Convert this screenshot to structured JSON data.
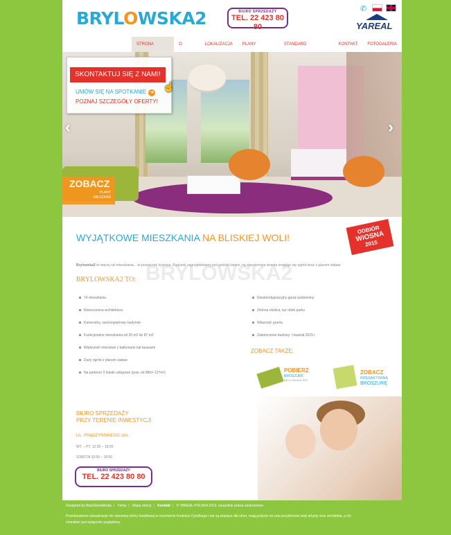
{
  "header": {
    "logo_main": "BRYL",
    "logo_o": "O",
    "logo_rest": "WSKA",
    "logo_num": "2",
    "phone_caption": "BIURO SPRZEDAŻY",
    "phone_number": "TEL. 22 423 80 80",
    "developer": "YAREAL",
    "icons": [
      "phone-icon",
      "flag-pl-icon",
      "flag-en-icon"
    ]
  },
  "nav": {
    "items": [
      {
        "label": "STRONA GŁÓWNA",
        "active": true
      },
      {
        "label": "O FIRMIE"
      },
      {
        "label": "LOKALIZACJA"
      },
      {
        "label": "PLANY MIESZKAŃ"
      },
      {
        "label": "STANDARD TECHNICZNY"
      },
      {
        "label": "KONTAKT"
      },
      {
        "label": "FOTOGALERIA"
      }
    ]
  },
  "hero": {
    "contact_button": "SKONTAKTUJ SIĘ Z NAMI!",
    "meeting_link": "UMÓW SIĘ NA SPOTKANIE",
    "details_link": "POZNAJ SZCZEGÓŁY OFERTY!",
    "see_title": "ZOBACZ",
    "see_sub1": "PLANY",
    "see_sub2": "MIESZKAŃ",
    "prev_symbol": "‹",
    "next_symbol": "›"
  },
  "main": {
    "tagline_part1": "WYJĄTKOWE MIESZKANIA",
    "tagline_part2": "NA BLISKIEJ WOLI!",
    "promo_line1": "ODBIÓR",
    "promo_line2": "WIOSNA",
    "promo_line3": "2015",
    "watermark": "BRYLOWSKA2",
    "intro_brand": "Brylowska2",
    "intro_rest": "to więcej niż mieszkania... to przestrzeń życiowa. Budynek zaprojektowany jest pośród zieleni, na ogrodzonym terenie znajduje się ogród wraz z placem zabaw",
    "section_title": "BRYLOWSKA2 TO:",
    "features_left": [
      "74 mieszkania",
      "Nowoczesna architektura",
      "Kameralny, sześciopiętrowy budynek",
      "Funkcjonalne mieszkania od 26 m2 do 87 m2",
      "Większość mieszkań z balkonami lub tarasami",
      "Duży ogród z placem zabaw",
      "Na parterze 3 lokale usługowe (pow. od 88m²-127m²)"
    ],
    "features_right": [
      "Dwukondygnacyjny garaż podziemny",
      "Zielona okolica, tuż obok parku",
      "Własność gruntu",
      "Zakończenie budowy: I kwartał 2015 r"
    ],
    "see_also": "ZOBACZ TAKŻE:",
    "download1": {
      "l1": "POBIERZ",
      "l2": "BROSZURĘ",
      "l3": "BRYLOWSKA-PDF"
    },
    "download2": {
      "l1": "ZOBACZ",
      "l2": "INTERAKTYWNĄ",
      "l3": "BROSZURĘ"
    }
  },
  "office": {
    "title_line1": "BIURO SPRZEDAŻY",
    "title_line2": "PRZY TERENIE INWESTYCJI",
    "address": "UL. PRĄDZYŃSKIEGO 14A",
    "hours_week": "WT. – PT. 12:00 – 18:00",
    "hours_sat": "SOBOTA 10:00 – 18:00",
    "phone_caption": "BIURO SPRZEDAŻY",
    "phone_number": "TEL. 22 423 80 80"
  },
  "footer": {
    "designed_by": "Designed by BlueStoneMedia",
    "links": [
      "Firma",
      "Mapa strony",
      "Kontakt"
    ],
    "copyright": "© YAREAL POLSKA 2013. wszystkie prawa zastrzeżone",
    "note": "Przedstawione wizualizacje nie stanowią oferty handlowej w rozumieniu Kodeksu Cywilnego i nie są wiążące dla stron, mają jedynie na celu przybliżenie wizji artysty oraz architekta, a ich charakter jest wyłącznie poglądowy."
  },
  "colors": {
    "background_green": "#8dc63f",
    "brand_blue": "#29a9d6",
    "brand_orange": "#f7941d",
    "brand_red": "#e4312b",
    "brand_purple": "#7b2a8b"
  }
}
